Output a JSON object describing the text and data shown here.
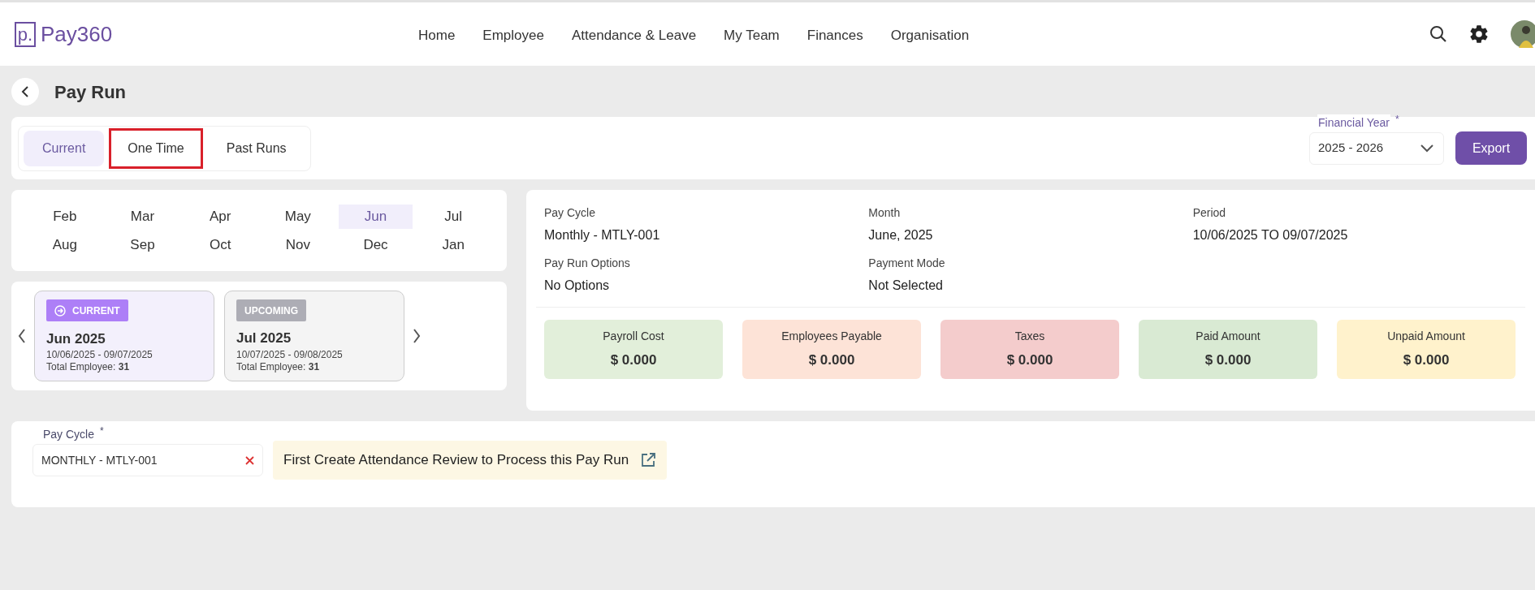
{
  "brand": {
    "logo_letter": "p.",
    "name": "Pay360"
  },
  "nav": [
    "Home",
    "Employee",
    "Attendance & Leave",
    "My Team",
    "Finances",
    "Organisation"
  ],
  "page": {
    "title": "Pay Run"
  },
  "tabs": [
    {
      "label": "Current",
      "selected": true,
      "highlighted": false
    },
    {
      "label": "One Time",
      "selected": false,
      "highlighted": true
    },
    {
      "label": "Past Runs",
      "selected": false,
      "highlighted": false
    }
  ],
  "financial_year": {
    "label": "Financial Year",
    "required_mark": "*",
    "value": "2025 - 2026"
  },
  "export_button": "Export",
  "months": [
    {
      "label": "Feb",
      "selected": false
    },
    {
      "label": "Mar",
      "selected": false
    },
    {
      "label": "Apr",
      "selected": false
    },
    {
      "label": "May",
      "selected": false
    },
    {
      "label": "Jun",
      "selected": true
    },
    {
      "label": "Jul",
      "selected": false
    },
    {
      "label": "Aug",
      "selected": false
    },
    {
      "label": "Sep",
      "selected": false
    },
    {
      "label": "Oct",
      "selected": false
    },
    {
      "label": "Nov",
      "selected": false
    },
    {
      "label": "Dec",
      "selected": false
    },
    {
      "label": "Jan",
      "selected": false
    }
  ],
  "runs": [
    {
      "status": "CURRENT",
      "kind": "current",
      "title": "Jun 2025",
      "range": "10/06/2025 - 09/07/2025",
      "employees_label": "Total Employee:",
      "employees": "31"
    },
    {
      "status": "UPCOMING",
      "kind": "upcoming",
      "title": "Jul 2025",
      "range": "10/07/2025 - 09/08/2025",
      "employees_label": "Total Employee:",
      "employees": "31"
    }
  ],
  "details": [
    {
      "label": "Pay Cycle",
      "value": "Monthly - MTLY-001"
    },
    {
      "label": "Month",
      "value": "June, 2025"
    },
    {
      "label": "Period",
      "value": "10/06/2025 TO 09/07/2025"
    },
    {
      "label": "Pay Run Options",
      "value": "No Options"
    },
    {
      "label": "Payment Mode",
      "value": "Not Selected"
    }
  ],
  "summary": [
    {
      "label": "Payroll Cost",
      "value": "$ 0.000",
      "color": "#e2efda"
    },
    {
      "label": "Employees Payable",
      "value": "$ 0.000",
      "color": "#fde3d7"
    },
    {
      "label": "Taxes",
      "value": "$ 0.000",
      "color": "#f4cccc"
    },
    {
      "label": "Paid Amount",
      "value": "$ 0.000",
      "color": "#d9ead3"
    },
    {
      "label": "Unpaid Amount",
      "value": "$ 0.000",
      "color": "#fff2cc"
    }
  ],
  "pay_cycle_field": {
    "label": "Pay Cycle",
    "required_mark": "*",
    "value": "MONTHLY - MTLY-001"
  },
  "notice": "First Create Attendance Review to Process this Pay Run"
}
